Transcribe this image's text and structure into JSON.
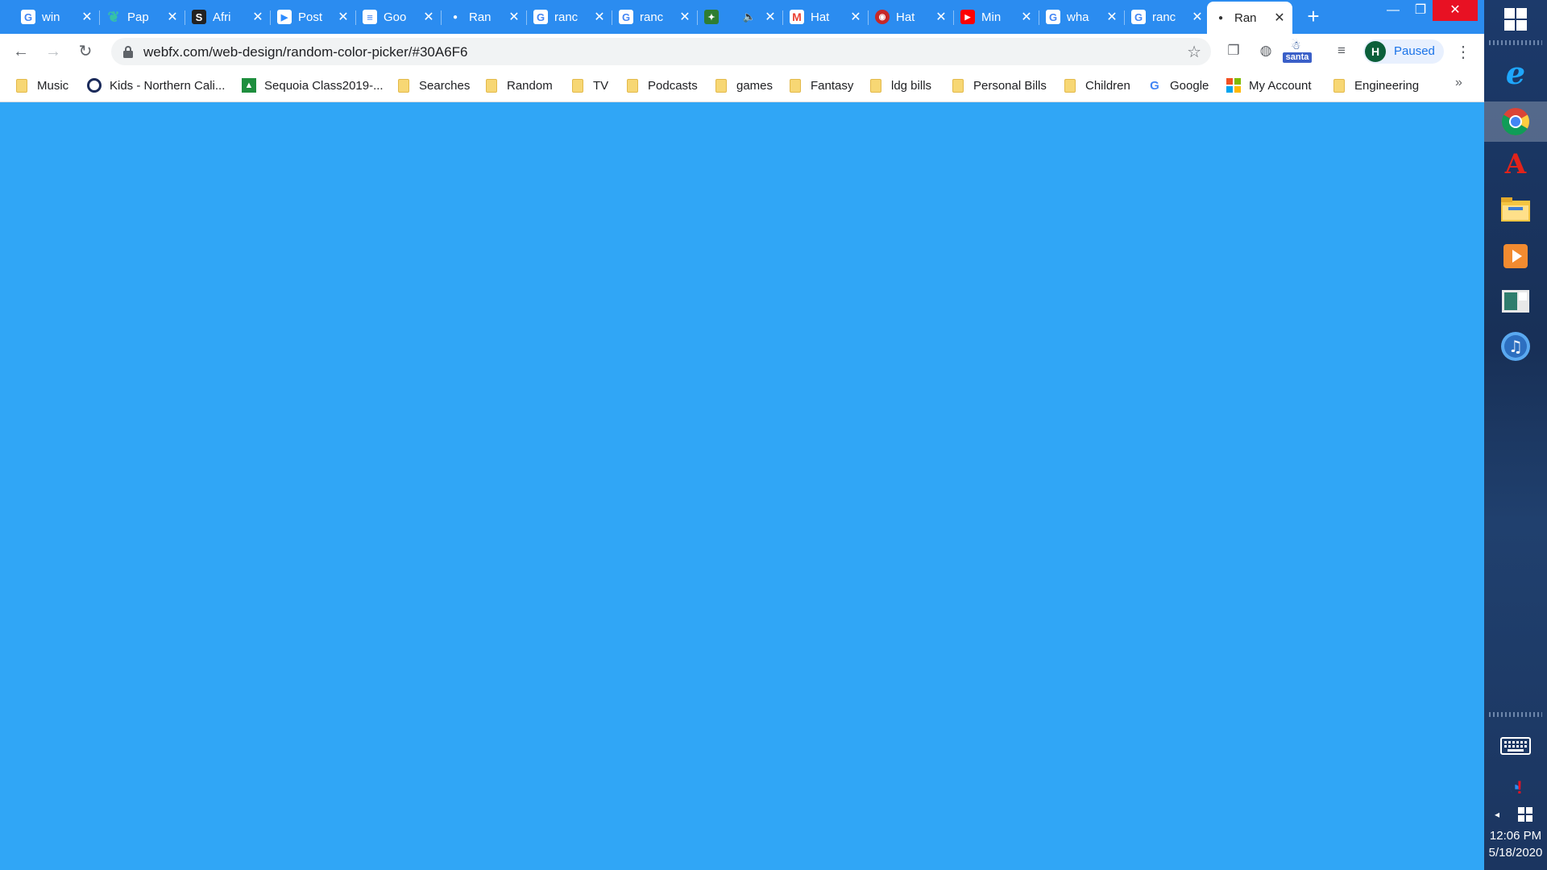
{
  "tabs": [
    {
      "title": "win",
      "favicon": "google-icon"
    },
    {
      "title": "Pap",
      "favicon": "paper-icon"
    },
    {
      "title": "Afri",
      "favicon": "sefaria-icon"
    },
    {
      "title": "Post",
      "favicon": "zoom-icon"
    },
    {
      "title": "Goo",
      "favicon": "google-docs-icon"
    },
    {
      "title": "Ran",
      "favicon": "dot-icon"
    },
    {
      "title": "ranc",
      "favicon": "google-icon"
    },
    {
      "title": "ranc",
      "favicon": "google-icon"
    },
    {
      "title": "",
      "favicon": "game-icon"
    },
    {
      "title": "Hat",
      "favicon": "gmail-icon"
    },
    {
      "title": "Hat",
      "favicon": "hat-icon"
    },
    {
      "title": "Min",
      "favicon": "youtube-icon"
    },
    {
      "title": "wha",
      "favicon": "google-icon"
    },
    {
      "title": "ranc",
      "favicon": "google-icon"
    },
    {
      "title": "Ran",
      "favicon": "dot-icon",
      "active": true
    }
  ],
  "toolbar": {
    "url": "webfx.com/web-design/random-color-picker/#30A6F6",
    "profile_initial": "H",
    "profile_status": "Paused",
    "santa_label": "santa"
  },
  "bookmarks": [
    {
      "label": "Music",
      "icon": "folder-icon"
    },
    {
      "label": "Kids - Northern Cali...",
      "icon": "ring-icon"
    },
    {
      "label": "Sequoia Class2019-...",
      "icon": "classroom-icon"
    },
    {
      "label": "Searches",
      "icon": "folder-icon"
    },
    {
      "label": "Random",
      "icon": "folder-icon"
    },
    {
      "label": "TV",
      "icon": "folder-icon"
    },
    {
      "label": "Podcasts",
      "icon": "folder-icon"
    },
    {
      "label": "games",
      "icon": "folder-icon"
    },
    {
      "label": "Fantasy",
      "icon": "folder-icon"
    },
    {
      "label": "ldg bills",
      "icon": "folder-icon"
    },
    {
      "label": "Personal Bills",
      "icon": "folder-icon"
    },
    {
      "label": "Children",
      "icon": "folder-icon"
    },
    {
      "label": "Google",
      "icon": "google-icon"
    },
    {
      "label": "My Account",
      "icon": "microsoft-icon"
    },
    {
      "label": "Engineering",
      "icon": "folder-icon"
    }
  ],
  "page": {
    "background_color": "#30A6F6"
  },
  "clock": {
    "time": "12:06 PM",
    "date": "5/18/2020"
  }
}
